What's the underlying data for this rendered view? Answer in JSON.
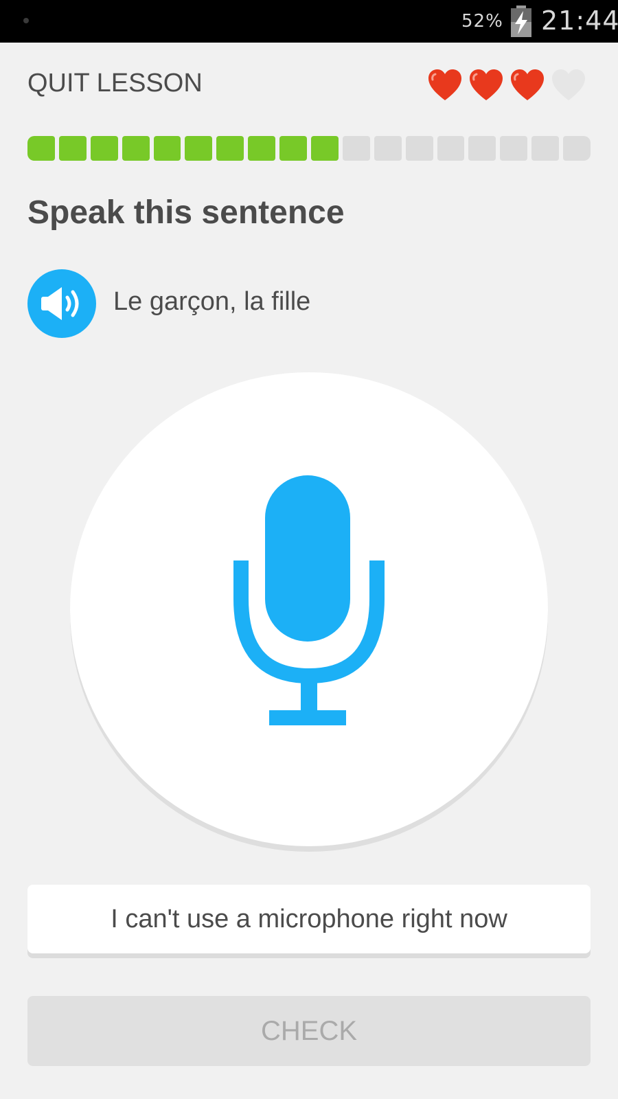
{
  "status_bar": {
    "battery_percent": "52%",
    "time": "21:44",
    "icons": [
      "notification-dot-icon",
      "battery-charging-icon"
    ]
  },
  "header": {
    "quit_label": "QUIT LESSON",
    "hearts_total": 4,
    "hearts_remaining": 3,
    "heart_color": "#e8391d",
    "heart_empty_color": "#e6e6e6"
  },
  "progress": {
    "total_segments": 18,
    "completed_segments": 10,
    "filled_color": "#78c928",
    "empty_color": "#dcdcdc"
  },
  "challenge": {
    "title": "Speak this sentence",
    "sentence": "Le garçon, la fille",
    "speaker_icon": "speaker-icon",
    "accent_color": "#1cb0f6"
  },
  "microphone": {
    "icon": "microphone-icon"
  },
  "buttons": {
    "no_mic_label": "I can't use a microphone right now",
    "check_label": "CHECK"
  }
}
